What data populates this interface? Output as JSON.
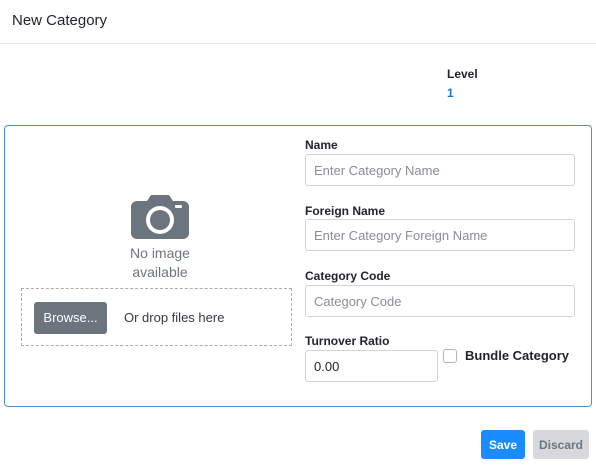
{
  "header": {
    "title": "New Category"
  },
  "level": {
    "label": "Level",
    "value": "1"
  },
  "image_panel": {
    "placeholder_icon": "camera-icon",
    "placeholder_line1": "No image",
    "placeholder_line2": "available",
    "browse_label": "Browse...",
    "drop_text": "Or drop files here"
  },
  "form": {
    "name": {
      "label": "Name",
      "placeholder": "Enter Category Name",
      "value": ""
    },
    "foreign_name": {
      "label": "Foreign Name",
      "placeholder": "Enter Category Foreign Name",
      "value": ""
    },
    "category_code": {
      "label": "Category Code",
      "placeholder": "Category Code",
      "value": ""
    },
    "turnover_ratio": {
      "label": "Turnover Ratio",
      "value": "0.00"
    },
    "bundle_category": {
      "label": "Bundle Category",
      "checked": false
    }
  },
  "actions": {
    "save_label": "Save",
    "discard_label": "Discard"
  },
  "colors": {
    "accent": "#1a8cff",
    "panel_border": "#4a90d9",
    "level_value": "#1a73e8"
  }
}
